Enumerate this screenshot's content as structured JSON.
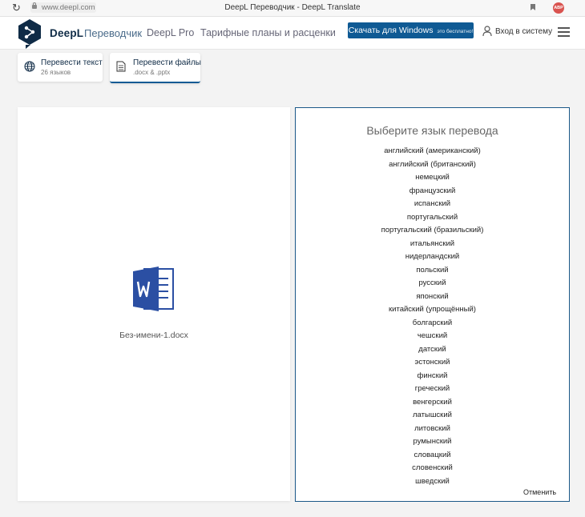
{
  "browser": {
    "url": "www.deepl.com",
    "tab_title": "DeepL Переводчик - DeepL Translate",
    "adblock_label": "ABP"
  },
  "header": {
    "brand": "DeepL",
    "nav": [
      "Переводчик",
      "DeepL Pro",
      "Тарифные планы и расценки"
    ],
    "download_button": "Скачать для Windows",
    "download_button_small": "это бесплатно!",
    "login": "Вход в систему"
  },
  "tabs": [
    {
      "label": "Перевести текст",
      "sub": "26 языков"
    },
    {
      "label": "Перевести файлы",
      "sub": ".docx & .pptx"
    }
  ],
  "document": {
    "icon": "word-document-icon",
    "file_name": "Без-имени-1.docx"
  },
  "language_picker": {
    "title": "Выберите язык перевода",
    "languages": [
      "английский (американский)",
      "английский (британский)",
      "немецкий",
      "французский",
      "испанский",
      "португальский",
      "португальский (бразильский)",
      "итальянский",
      "нидерландский",
      "польский",
      "русский",
      "японский",
      "китайский (упрощённый)",
      "болгарский",
      "чешский",
      "датский",
      "эстонский",
      "финский",
      "греческий",
      "венгерский",
      "латышский",
      "литовский",
      "румынский",
      "словацкий",
      "словенский",
      "шведский"
    ],
    "cancel": "Отменить"
  },
  "colors": {
    "brand_dark": "#0f2b46",
    "accent": "#0f5a94",
    "word_blue": "#2b4fa3"
  }
}
